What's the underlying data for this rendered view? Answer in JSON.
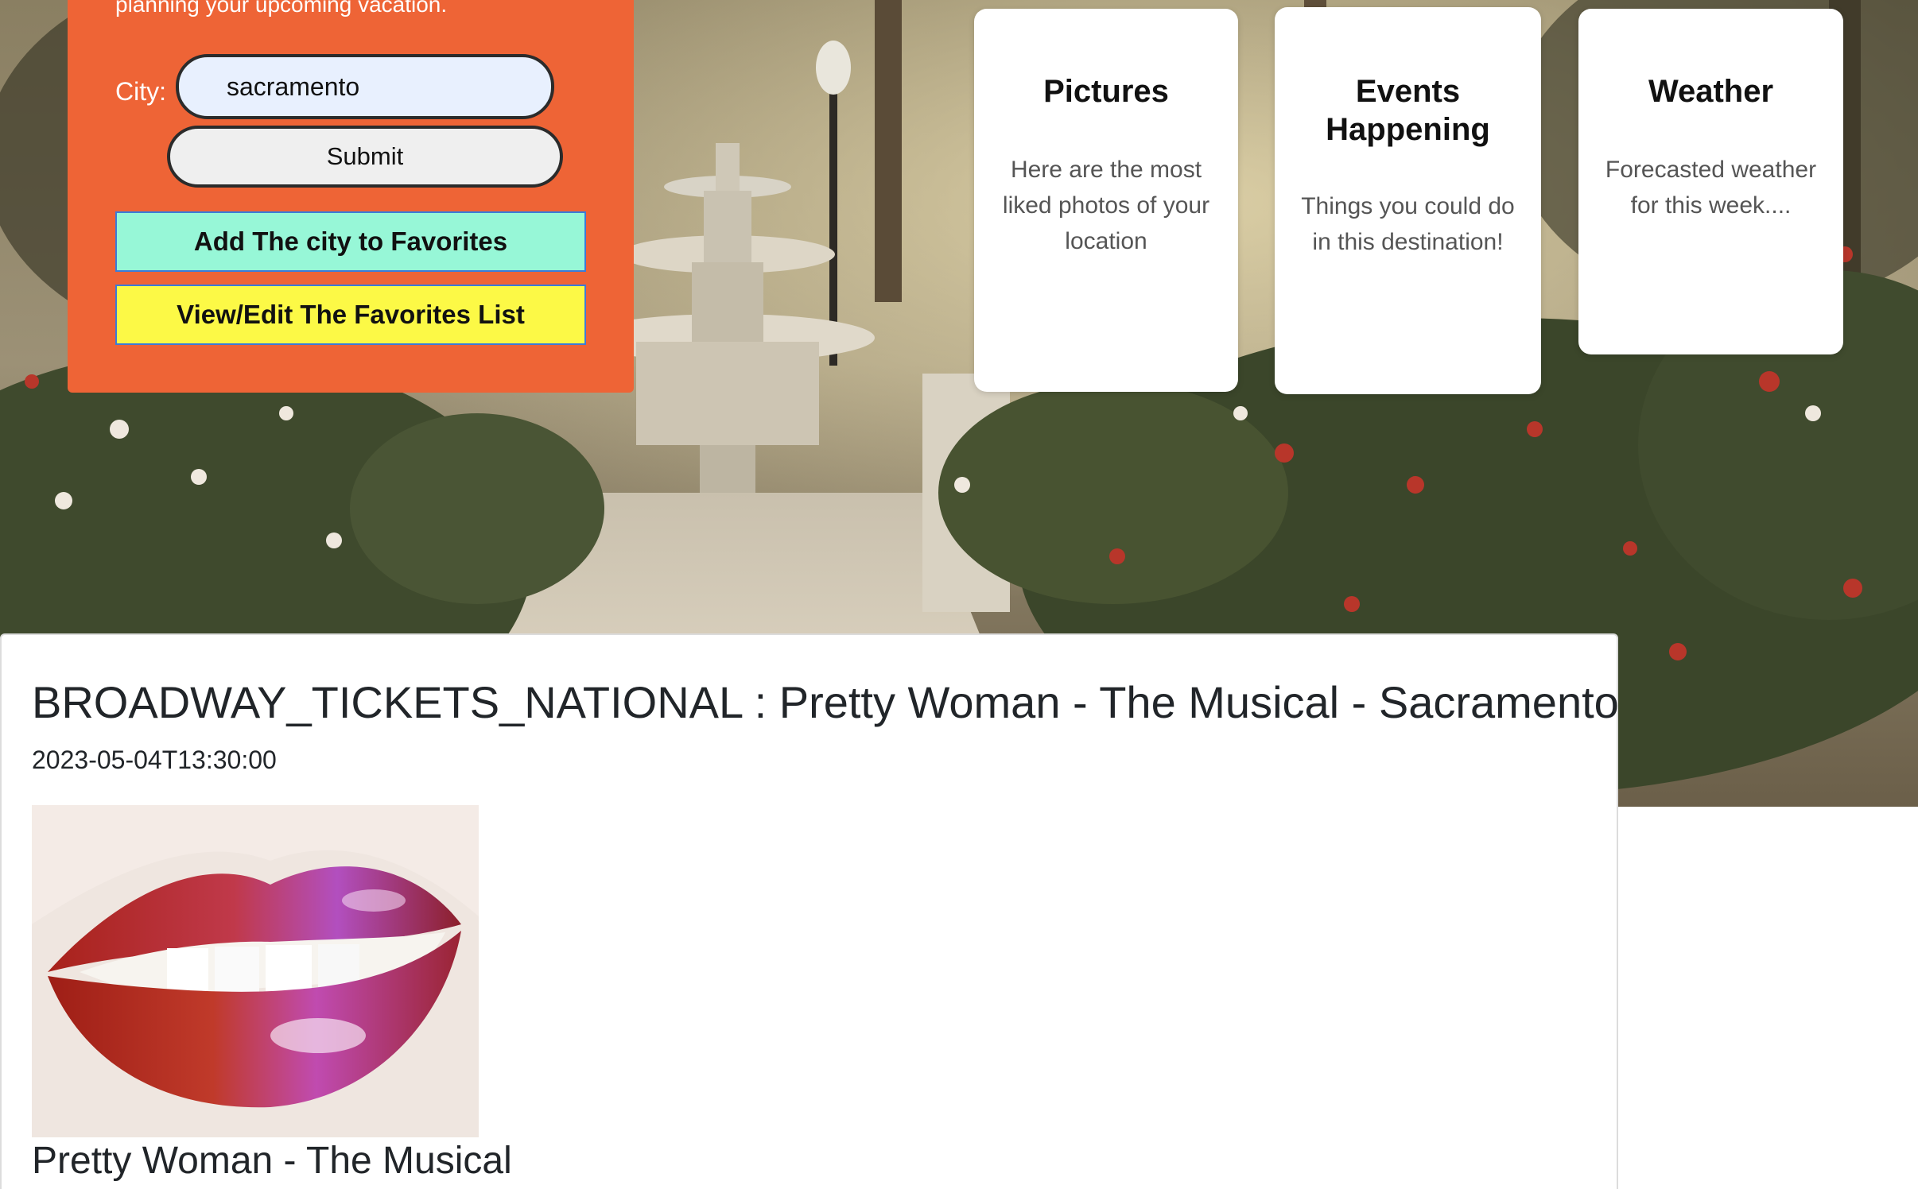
{
  "search_panel": {
    "intro_text": "planning your upcoming vacation.",
    "city_label": "City:",
    "city_value": "sacramento",
    "submit_label": "Submit",
    "add_favorite_label": "Add The city to Favorites",
    "view_favorites_label": "View/Edit The Favorites List"
  },
  "cards": [
    {
      "title": "Pictures",
      "description": "Here are the most liked photos of your location"
    },
    {
      "title": "Events Happening",
      "description": "Things you could do in this destination!"
    },
    {
      "title": "Weather",
      "description": "Forecasted weather for this week...."
    }
  ],
  "event": {
    "heading": "BROADWAY_TICKETS_NATIONAL : Pretty Woman - The Musical - Sacramento",
    "datetime": "2023-05-04T13:30:00",
    "name": "Pretty Woman - The Musical"
  },
  "colors": {
    "panel_orange": "#ee6436",
    "favorite_green": "#97f7d7",
    "favorite_yellow": "#fcf946",
    "input_fill": "#e8f0fe"
  }
}
